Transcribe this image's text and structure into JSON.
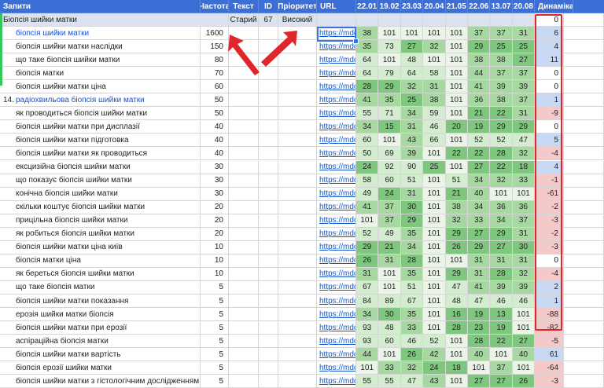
{
  "colors": {
    "header_bg": "#3c6fd6",
    "green_dark": "#7fc77f",
    "green_mid": "#a8d8a2",
    "green_light": "#d4ecd0",
    "pos_blue": "#c9d8f3",
    "neg_red": "#f4c9c9",
    "annotation_red": "#e0262b"
  },
  "headers": {
    "query": "Запити",
    "freq": "Частота",
    "text": "Текст",
    "id": "ID",
    "priority": "Пріоритет",
    "url": "URL",
    "dates": [
      "22.01",
      "19.02",
      "23.03",
      "20.04",
      "21.05",
      "22.06",
      "13.07",
      "20.08"
    ],
    "dynamics": "Динаміка"
  },
  "group_row": {
    "query": "Біопсія шийки матки",
    "text": "Старий",
    "id": "67",
    "priority": "Високий",
    "dynamics": "0"
  },
  "row_number_label": "14.",
  "rows": [
    {
      "q": "біопсія шийки матки",
      "f": "1600",
      "url": "https://mdc",
      "pos": [
        "38",
        "101",
        "101",
        "101",
        "101",
        "37",
        "37",
        "31"
      ],
      "d": "6",
      "blue": true
    },
    {
      "q": "біопсія шийки матки наслідки",
      "f": "150",
      "url": "https://mdc",
      "pos": [
        "35",
        "73",
        "27",
        "32",
        "101",
        "29",
        "25",
        "25"
      ],
      "d": "4"
    },
    {
      "q": "що таке біопсія шийки матки",
      "f": "80",
      "url": "https://mdc",
      "pos": [
        "64",
        "101",
        "48",
        "101",
        "101",
        "38",
        "38",
        "27"
      ],
      "d": "11"
    },
    {
      "q": "біопсія матки",
      "f": "70",
      "url": "https://mdc",
      "pos": [
        "64",
        "79",
        "64",
        "58",
        "101",
        "44",
        "37",
        "37"
      ],
      "d": "0"
    },
    {
      "q": "біопсія шийки матки ціна",
      "f": "60",
      "url": "https://mdc",
      "pos": [
        "28",
        "29",
        "32",
        "31",
        "101",
        "41",
        "39",
        "39"
      ],
      "d": "0"
    },
    {
      "q": "радіохвильова біопсія шийки матки",
      "f": "50",
      "url": "https://mdc",
      "pos": [
        "41",
        "35",
        "25",
        "38",
        "101",
        "36",
        "38",
        "37"
      ],
      "d": "1",
      "blue": true
    },
    {
      "q": "як проводиться біопсія шийки матки",
      "f": "50",
      "url": "https://mdc",
      "pos": [
        "55",
        "71",
        "34",
        "59",
        "101",
        "21",
        "22",
        "31"
      ],
      "d": "-9"
    },
    {
      "q": "біопсія шийки матки при дисплазії",
      "f": "40",
      "url": "https://mdc",
      "pos": [
        "34",
        "15",
        "31",
        "46",
        "20",
        "19",
        "29",
        "29"
      ],
      "d": "0"
    },
    {
      "q": "біопсія шийки матки підготовка",
      "f": "40",
      "url": "https://mdc",
      "pos": [
        "60",
        "101",
        "43",
        "66",
        "101",
        "52",
        "52",
        "47"
      ],
      "d": "5"
    },
    {
      "q": "біопсія шийки матки як проводиться",
      "f": "40",
      "url": "https://mdc",
      "pos": [
        "50",
        "69",
        "39",
        "101",
        "22",
        "22",
        "28",
        "32"
      ],
      "d": "-4"
    },
    {
      "q": "ексцизійна біопсія шийки матки",
      "f": "30",
      "url": "https://mdc",
      "pos": [
        "24",
        "92",
        "90",
        "25",
        "101",
        "27",
        "22",
        "18"
      ],
      "d": "4"
    },
    {
      "q": "що показує біопсія шийки матки",
      "f": "30",
      "url": "https://mdc",
      "pos": [
        "58",
        "60",
        "51",
        "101",
        "51",
        "34",
        "32",
        "33"
      ],
      "d": "-1"
    },
    {
      "q": "конічна біопсія шийки матки",
      "f": "30",
      "url": "https://mdc",
      "pos": [
        "49",
        "24",
        "31",
        "101",
        "21",
        "40",
        "101",
        "101"
      ],
      "d": "-61"
    },
    {
      "q": "скільки коштує біопсія шийки матки",
      "f": "20",
      "url": "https://mdc",
      "pos": [
        "41",
        "37",
        "30",
        "101",
        "38",
        "34",
        "36",
        "36"
      ],
      "d": "-2"
    },
    {
      "q": "прицільна біопсія шийки матки",
      "f": "20",
      "url": "https://mdc",
      "pos": [
        "101",
        "37",
        "29",
        "101",
        "32",
        "33",
        "34",
        "37"
      ],
      "d": "-3"
    },
    {
      "q": "як робиться біопсія шийки матки",
      "f": "20",
      "url": "https://mdc",
      "pos": [
        "52",
        "49",
        "35",
        "101",
        "29",
        "27",
        "29",
        "31"
      ],
      "d": "-2"
    },
    {
      "q": "біопсія шийки матки ціна київ",
      "f": "10",
      "url": "https://mdc",
      "pos": [
        "29",
        "21",
        "34",
        "101",
        "26",
        "29",
        "27",
        "30"
      ],
      "d": "-3"
    },
    {
      "q": "біопсія матки ціна",
      "f": "10",
      "url": "https://mdc",
      "pos": [
        "26",
        "31",
        "28",
        "101",
        "101",
        "31",
        "31",
        "31"
      ],
      "d": "0"
    },
    {
      "q": "як береться біопсія шийки матки",
      "f": "10",
      "url": "https://mdc",
      "pos": [
        "31",
        "101",
        "35",
        "101",
        "29",
        "31",
        "28",
        "32"
      ],
      "d": "-4"
    },
    {
      "q": "що таке біопсія матки",
      "f": "5",
      "url": "https://mdc",
      "pos": [
        "67",
        "101",
        "51",
        "101",
        "47",
        "41",
        "39",
        "39"
      ],
      "d": "2"
    },
    {
      "q": "біопсія шийки матки показання",
      "f": "5",
      "url": "https://mdc",
      "pos": [
        "84",
        "89",
        "67",
        "101",
        "48",
        "47",
        "46",
        "46"
      ],
      "d": "1"
    },
    {
      "q": "ерозія шийки матки біопсія",
      "f": "5",
      "url": "https://mdc",
      "pos": [
        "34",
        "30",
        "35",
        "101",
        "16",
        "19",
        "13",
        "101"
      ],
      "d": "-88"
    },
    {
      "q": "біопсія шийки матки при ерозії",
      "f": "5",
      "url": "https://mdc",
      "pos": [
        "93",
        "48",
        "33",
        "101",
        "28",
        "23",
        "19",
        "101"
      ],
      "d": "-82"
    },
    {
      "q": "аспіраційна біопсія матки",
      "f": "5",
      "url": "https://mdc",
      "pos": [
        "93",
        "60",
        "46",
        "52",
        "101",
        "28",
        "22",
        "27"
      ],
      "d": "-5"
    },
    {
      "q": "біопсія шийки матки вартість",
      "f": "5",
      "url": "https://mdc",
      "pos": [
        "44",
        "101",
        "26",
        "42",
        "101",
        "40",
        "101",
        "40"
      ],
      "d": "61"
    },
    {
      "q": "біопсія ерозії шийки матки",
      "f": "5",
      "url": "https://mdc",
      "pos": [
        "101",
        "33",
        "32",
        "24",
        "18",
        "101",
        "37",
        "101"
      ],
      "d": "-64"
    },
    {
      "q": "біопсія шийки матки з гістологічним дослідженням",
      "f": "5",
      "url": "https://mdc",
      "pos": [
        "55",
        "55",
        "47",
        "43",
        "101",
        "27",
        "27",
        "26"
      ],
      "d": "-3"
    }
  ]
}
